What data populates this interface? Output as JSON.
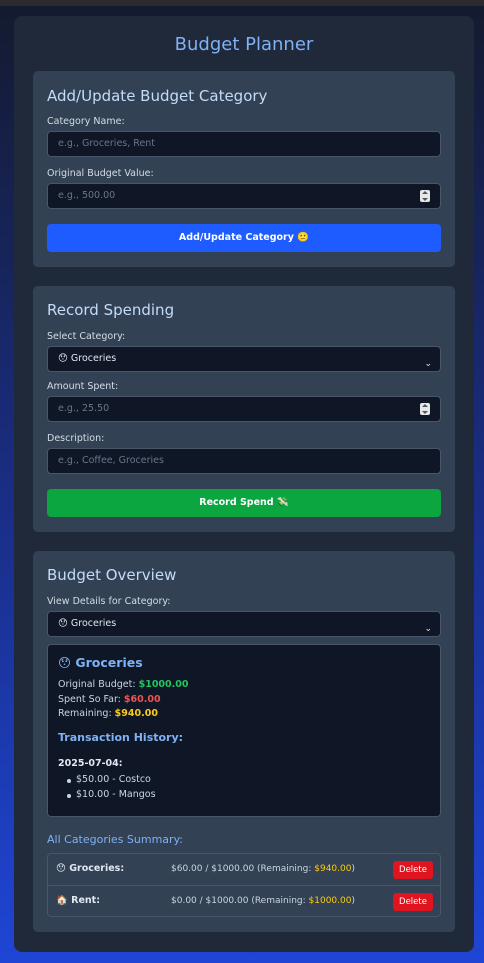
{
  "app": {
    "title": "Budget Planner"
  },
  "add_category": {
    "title": "Add/Update Budget Category",
    "name_label": "Category Name:",
    "name_placeholder": "e.g., Groceries, Rent",
    "budget_label": "Original Budget Value:",
    "budget_placeholder": "e.g., 500.00",
    "button_label": "Add/Update Category 🙂"
  },
  "record_spending": {
    "title": "Record Spending",
    "category_label": "Select Category:",
    "category_value": "😯 Groceries",
    "amount_label": "Amount Spent:",
    "amount_placeholder": "e.g., 25.50",
    "description_label": "Description:",
    "description_placeholder": "e.g., Coffee, Groceries",
    "button_label": "Record Spend 💸"
  },
  "overview": {
    "title": "Budget Overview",
    "view_label": "View Details for Category:",
    "view_value": "😯 Groceries",
    "details": {
      "title": "😯 Groceries",
      "original_label": "Original Budget: ",
      "original_value": "$1000.00",
      "spent_label": "Spent So Far: ",
      "spent_value": "$60.00",
      "remaining_label": "Remaining: ",
      "remaining_value": "$940.00",
      "history_title": "Transaction History:",
      "date": "2025-07-04:",
      "transactions": [
        "$50.00 - Costco",
        "$10.00 - Mangos"
      ]
    },
    "summary_title": "All Categories Summary:",
    "summary": [
      {
        "name": "😯 Groceries:",
        "amount": "$60.00 / $1000.00 (Remaining: ",
        "remaining": "$940.00",
        "close": ")",
        "delete_label": "Delete"
      },
      {
        "name": "🏠 Rent:",
        "amount": "$0.00 / $1000.00 (Remaining: ",
        "remaining": "$1000.00",
        "close": ")",
        "delete_label": "Delete"
      }
    ]
  }
}
